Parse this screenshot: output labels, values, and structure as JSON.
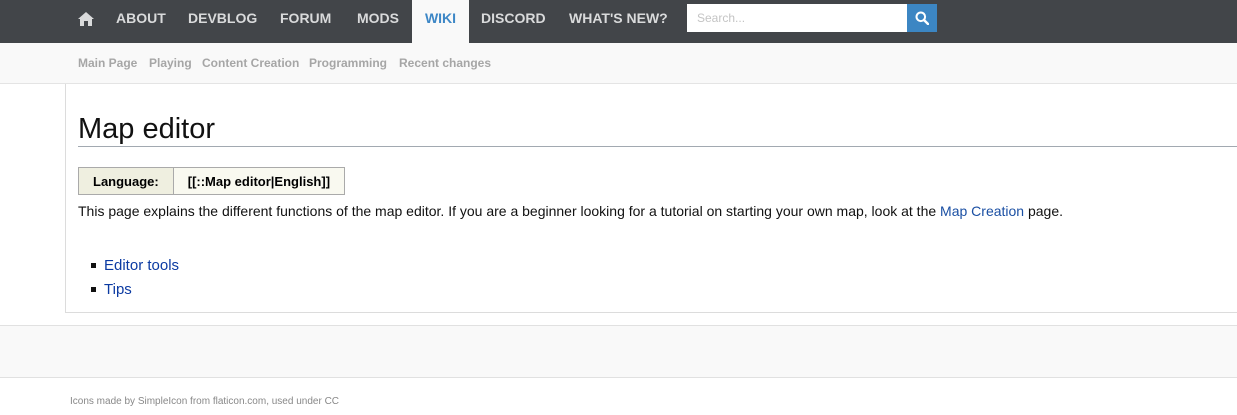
{
  "topnav": {
    "home_icon": "home-icon",
    "items": [
      {
        "label": "ABOUT",
        "active": false
      },
      {
        "label": "DEVBLOG",
        "active": false
      },
      {
        "label": "FORUM",
        "active": false
      },
      {
        "label": "MODS",
        "active": false
      },
      {
        "label": "WIKI",
        "active": true
      },
      {
        "label": "DISCORD",
        "active": false
      },
      {
        "label": "WHAT'S NEW?",
        "active": false
      }
    ],
    "search": {
      "placeholder": "Search...",
      "value": "",
      "icon": "search-icon"
    },
    "colors": {
      "bar": "#424549",
      "active_text": "#3d87c6",
      "search_button": "#3c86c3"
    }
  },
  "subnav": {
    "items": [
      {
        "label": "Main Page"
      },
      {
        "label": "Playing"
      },
      {
        "label": "Content Creation"
      },
      {
        "label": "Programming"
      },
      {
        "label": "Recent changes"
      }
    ]
  },
  "page": {
    "title": "Map editor",
    "language_table": {
      "label": "Language:",
      "value": "[[::Map editor|English]]"
    },
    "intro": {
      "before_link": "This page explains the different functions of the map editor. If you are a beginner looking for a tutorial on starting your own map, look at the ",
      "link": "Map Creation",
      "after_link": " page."
    },
    "toc": [
      {
        "label": "Editor tools"
      },
      {
        "label": "Tips"
      }
    ]
  },
  "footer": {
    "credit": "Icons made by SimpleIcon from flaticon.com, used under CC"
  }
}
